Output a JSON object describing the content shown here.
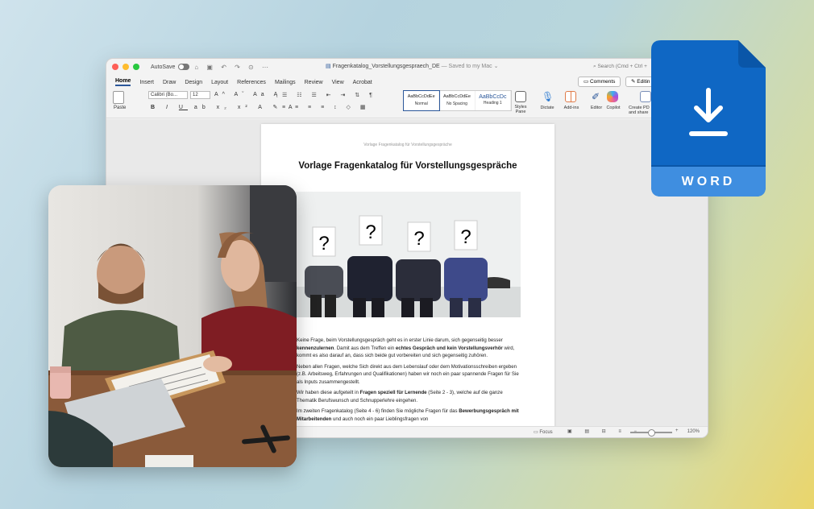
{
  "window": {
    "autosave_label": "AutoSave",
    "doc_title": "Fragenkatalog_Vorstellungsgespraech_DE",
    "saved_status": " — Saved to my Mac ⌄",
    "search_placeholder": "Search (Cmd + Ctrl + U)",
    "search_visible": "Search (Cmd + Ctrl +"
  },
  "menu": {
    "tabs": [
      "Home",
      "Insert",
      "Draw",
      "Design",
      "Layout",
      "References",
      "Mailings",
      "Review",
      "View",
      "Acrobat"
    ],
    "active": "Home",
    "comments_label": "Comments",
    "editing_label": "Editin"
  },
  "ribbon": {
    "paste_label": "Paste",
    "font_name": "Calibri (Bo...",
    "font_size": "12",
    "styles": [
      {
        "preview": "AaBbCcDdEe",
        "name": "Normal"
      },
      {
        "preview": "AaBbCcDdEe",
        "name": "No Spacing"
      },
      {
        "preview": "AaBbCcDc",
        "name": "Heading 1"
      }
    ],
    "styles_pane": "Styles\nPane",
    "dictate": "Dictate",
    "addins": "Add-ins",
    "editor": "Editor",
    "copilot": "Copilot",
    "create_pdf": "Create PD\nand share"
  },
  "document": {
    "header": "Vorlage Fragenkatalog für Vorstellungsgespräche",
    "title": "Vorlage Fragenkatalog für Vorstellungsgespräche",
    "p1a": "Keine Frage, beim Vorstellungsgespräch geht es in erster Linie darum, sich gegenseitig besser ",
    "p1b": "kennenzulernen",
    "p1c": ". Damit aus dem Treffen ein ",
    "p1d": "echtes Gespräch und kein Vorstellungsverhör",
    "p1e": " wird, kommt es also darauf an, dass sich beide gut vorbereiten und sich gegenseitig zuhören.",
    "p2": "Neben allen Fragen, welche Sich direkt aus dem Lebenslauf oder dem Motivationsschreiben ergeben (z.B. Arbeitsweg, Erfahrungen und Qualifikationen) haben wir noch ein paar spannende Fragen für Sie als Inputs zusammengestellt.",
    "p3a": "Wir haben diese aufgeteilt in ",
    "p3b": "Fragen speziell für Lernende",
    "p3c": " (Seite 2 - 3), welche auf die ganze Thematik Berufswunsch und Schnupperlehre eingehen.",
    "p4a": "Im zweiten Fragenkatalog (Seite 4 - 6) finden Sie mögliche Fragen für das ",
    "p4b": "Bewerbungsgespräch mit Mitarbeitenden",
    "p4c": " und auch noch ein paar Lieblingsfragen von"
  },
  "statusbar": {
    "focus": "Focus",
    "zoom": "120%"
  },
  "badge": {
    "label": "WORD"
  },
  "colors": {
    "word_blue": "#0f67c4",
    "word_dark": "#0a56a8",
    "word_light": "#3f8ee0",
    "accent": "#2b579a"
  }
}
